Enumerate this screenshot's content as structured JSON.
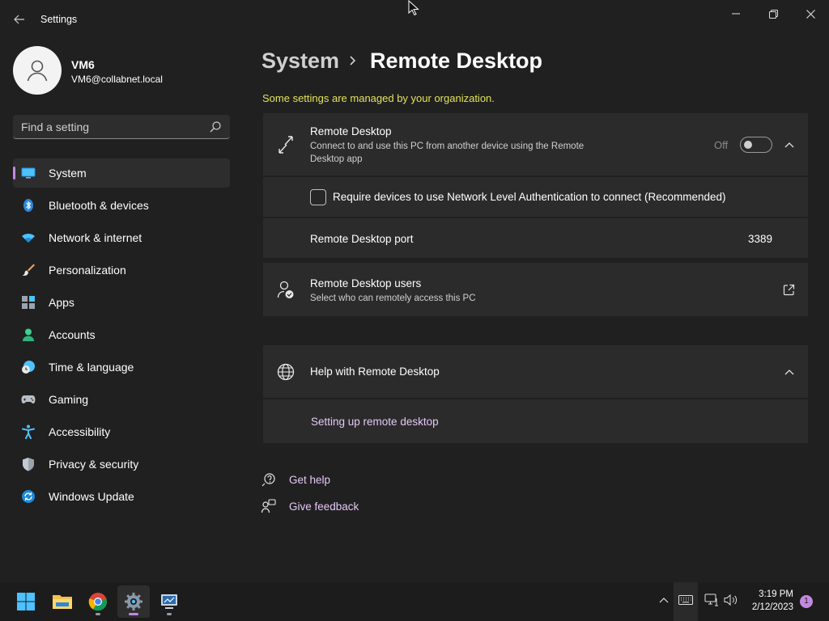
{
  "window": {
    "app_title": "Settings"
  },
  "user": {
    "name": "VM6",
    "email": "VM6@collabnet.local"
  },
  "search": {
    "placeholder": "Find a setting"
  },
  "nav": {
    "items": [
      {
        "label": "System",
        "icon": "system-icon",
        "selected": true
      },
      {
        "label": "Bluetooth & devices",
        "icon": "bluetooth-icon"
      },
      {
        "label": "Network & internet",
        "icon": "wifi-icon"
      },
      {
        "label": "Personalization",
        "icon": "brush-icon"
      },
      {
        "label": "Apps",
        "icon": "apps-icon"
      },
      {
        "label": "Accounts",
        "icon": "accounts-icon"
      },
      {
        "label": "Time & language",
        "icon": "time-language-icon"
      },
      {
        "label": "Gaming",
        "icon": "gamepad-icon"
      },
      {
        "label": "Accessibility",
        "icon": "accessibility-icon"
      },
      {
        "label": "Privacy & security",
        "icon": "shield-icon"
      },
      {
        "label": "Windows Update",
        "icon": "update-icon"
      }
    ]
  },
  "header": {
    "parent": "System",
    "current": "Remote Desktop",
    "managed_notice": "Some settings are managed by your organization."
  },
  "remote_desktop": {
    "title": "Remote Desktop",
    "description": "Connect to and use this PC from another device using the Remote Desktop app",
    "toggle_state": "Off",
    "toggle_on": false,
    "nla_label": "Require devices to use Network Level Authentication to connect (Recommended)",
    "nla_checked": false,
    "port_label": "Remote Desktop port",
    "port_value": "3389"
  },
  "users_card": {
    "title": "Remote Desktop users",
    "description": "Select who can remotely access this PC"
  },
  "help": {
    "title": "Help with Remote Desktop",
    "link": "Setting up remote desktop"
  },
  "footer_links": {
    "get_help": "Get help",
    "give_feedback": "Give feedback"
  },
  "taskbar": {
    "apps": [
      "start-icon",
      "file-explorer-icon",
      "chrome-icon",
      "settings-icon",
      "remote-desktop-icon"
    ],
    "active_app": "settings-icon",
    "time": "3:19 PM",
    "date": "2/12/2023",
    "notification_count": "1"
  },
  "colors": {
    "background": "#202020",
    "card": "#2b2b2b",
    "accent": "#c289e0",
    "managed_notice": "#e1e35a",
    "link": "#e4c8f5"
  }
}
